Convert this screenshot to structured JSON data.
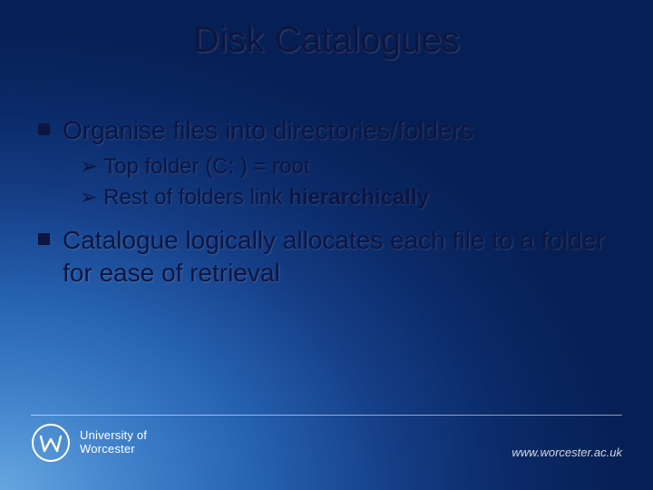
{
  "title": "Disk Catalogues",
  "bullets": [
    {
      "text": "Organise files into directories/folders",
      "sub": [
        {
          "text": "Top folder (C: ) = root"
        },
        {
          "prefix": "Rest of folders link ",
          "bold": "hierarchically"
        }
      ]
    },
    {
      "text": "Catalogue logically allocates each file to a folder for ease of retrieval"
    }
  ],
  "footer": {
    "institution_line1": "University of",
    "institution_line2": "Worcester",
    "url": "www.worcester.ac.uk"
  }
}
